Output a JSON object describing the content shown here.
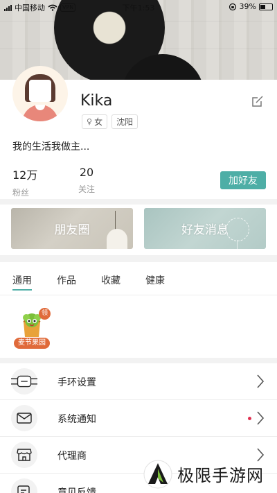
{
  "status_bar": {
    "carrier": "中国移动",
    "vpn": "VPN",
    "time": "下午1:53",
    "battery": "39%"
  },
  "profile": {
    "name": "Kika",
    "gender": "女",
    "city": "沈阳",
    "bio": "我的生活我做主...",
    "stats": [
      {
        "value": "12万",
        "label": "粉丝"
      },
      {
        "value": "20",
        "label": "关注"
      }
    ],
    "add_friend": "加好友"
  },
  "features": {
    "moments": "朋友圈",
    "friend_messages": "好友消息"
  },
  "tabs": [
    "通用",
    "作品",
    "收藏",
    "健康"
  ],
  "apps": [
    {
      "label": "麦节果园",
      "badge": "领"
    }
  ],
  "menu": [
    {
      "label": "手环设置",
      "icon": "wristband-icon"
    },
    {
      "label": "系统通知",
      "icon": "mail-icon",
      "has_dot": true
    },
    {
      "label": "代理商",
      "icon": "store-icon"
    },
    {
      "label": "意见反馈",
      "icon": "feedback-icon"
    }
  ],
  "watermark": {
    "text": "极限手游网"
  },
  "colors": {
    "accent": "#4eaea6",
    "notification_dot": "#e03050",
    "app_label": "#e06a3a"
  }
}
